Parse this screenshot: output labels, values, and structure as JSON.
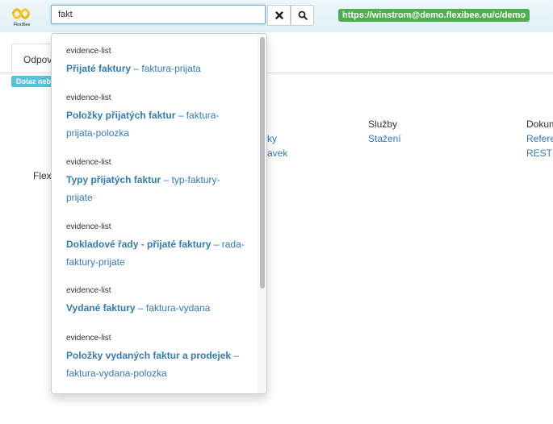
{
  "header": {
    "logo_text": "FlexiBee",
    "search": {
      "value": "fakt",
      "placeholder": ""
    },
    "clear_icon": "close-icon",
    "search_icon": "search-icon",
    "url_badge": "https://winstrom@demo.flexibee.eu/c/demo"
  },
  "background": {
    "tab_label": "Odpověď",
    "info_label": "Dotaz nebyl",
    "left_text": "Flexi",
    "col2_links": [
      "ky",
      "avek"
    ],
    "services": {
      "title": "Služby",
      "link": "Stažení"
    },
    "docs": {
      "title": "Dokum",
      "links": [
        "Refere",
        "REST"
      ]
    }
  },
  "dropdown": {
    "items": [
      {
        "type": "evidence-list",
        "title": "Přijaté faktury",
        "sep": " – ",
        "code": "faktura-prijata"
      },
      {
        "type": "evidence-list",
        "title": "Položky přijatých faktur",
        "sep": " – ",
        "code": "faktura-prijata-polozka"
      },
      {
        "type": "evidence-list",
        "title": "Typy přijatých faktur",
        "sep": " – ",
        "code": "typ-faktury-prijate"
      },
      {
        "type": "evidence-list",
        "title": "Dokladové řady - přijaté faktury",
        "sep": " – ",
        "code": "rada-faktury-prijate"
      },
      {
        "type": "evidence-list",
        "title": "Vydané faktury",
        "sep": " – ",
        "code": "faktura-vydana"
      },
      {
        "type": "evidence-list",
        "title": "Položky vydaných faktur a prodejek",
        "sep": " – ",
        "code": "faktura-vydana-polozka"
      }
    ]
  },
  "colors": {
    "link": "#337ab7",
    "badge_green": "#4cae4c",
    "info_blue": "#5bc0de"
  }
}
